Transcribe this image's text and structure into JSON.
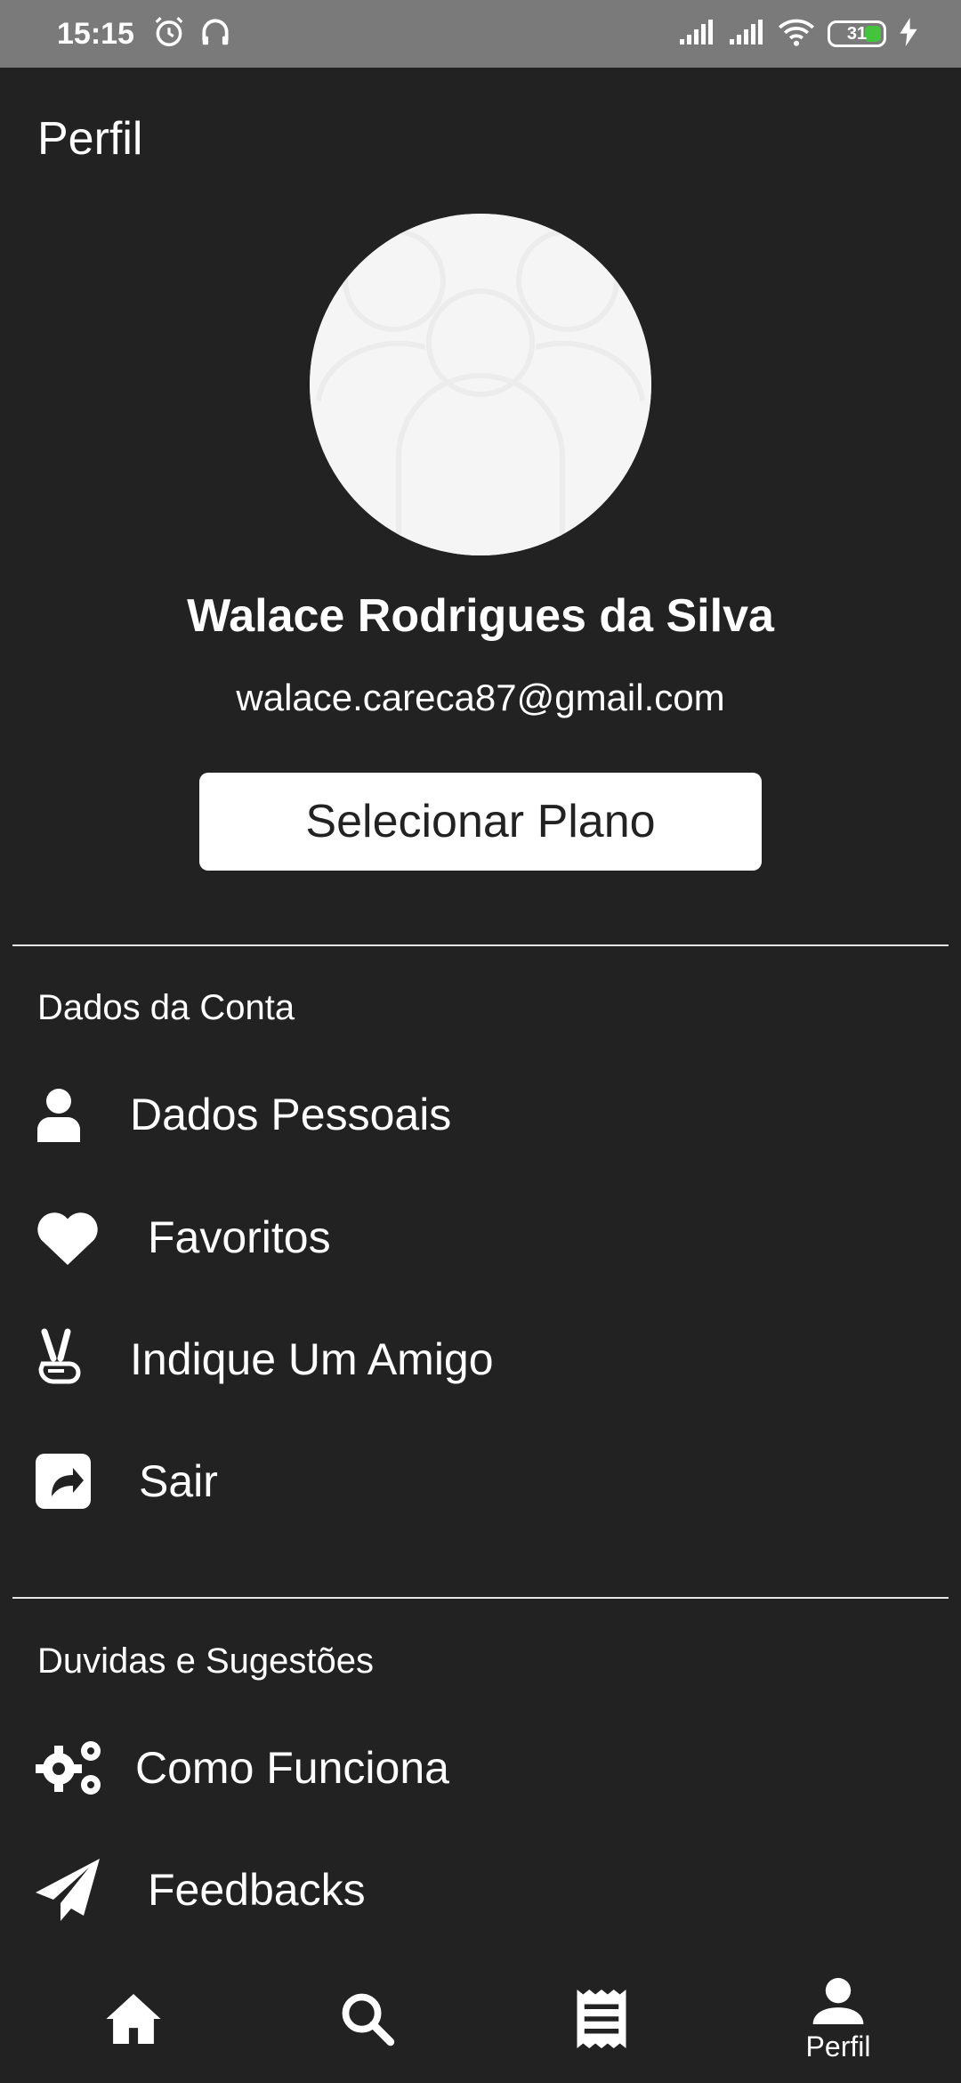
{
  "status_bar": {
    "time": "15:15",
    "battery": "31",
    "icons": [
      "alarm-icon",
      "headphones-icon",
      "signal-icon",
      "signal-icon",
      "wifi-icon",
      "battery-icon",
      "charging-icon"
    ]
  },
  "header": {
    "title": "Perfil"
  },
  "profile": {
    "name": "Walace Rodrigues da Silva",
    "email": "walace.careca87@gmail.com",
    "plan_button": "Selecionar Plano"
  },
  "sections": [
    {
      "heading": "Dados da Conta",
      "items": [
        {
          "label": "Dados Pessoais",
          "icon": "user-icon"
        },
        {
          "label": "Favoritos",
          "icon": "heart-icon"
        },
        {
          "label": "Indique Um Amigo",
          "icon": "peace-hand-icon"
        },
        {
          "label": "Sair",
          "icon": "share-icon"
        }
      ]
    },
    {
      "heading": "Duvidas e Sugestões",
      "items": [
        {
          "label": "Como Funciona",
          "icon": "gears-icon"
        },
        {
          "label": "Feedbacks",
          "icon": "paper-plane-icon"
        }
      ]
    }
  ],
  "bottom_nav": {
    "items": [
      {
        "icon": "home-icon",
        "label": ""
      },
      {
        "icon": "search-icon",
        "label": ""
      },
      {
        "icon": "receipt-icon",
        "label": ""
      },
      {
        "icon": "person-icon",
        "label": "Perfil",
        "active": true
      }
    ]
  },
  "colors": {
    "background": "#222222",
    "status_bar": "#7a7a7a",
    "battery_fill": "#44c43c",
    "text": "#ffffff"
  }
}
